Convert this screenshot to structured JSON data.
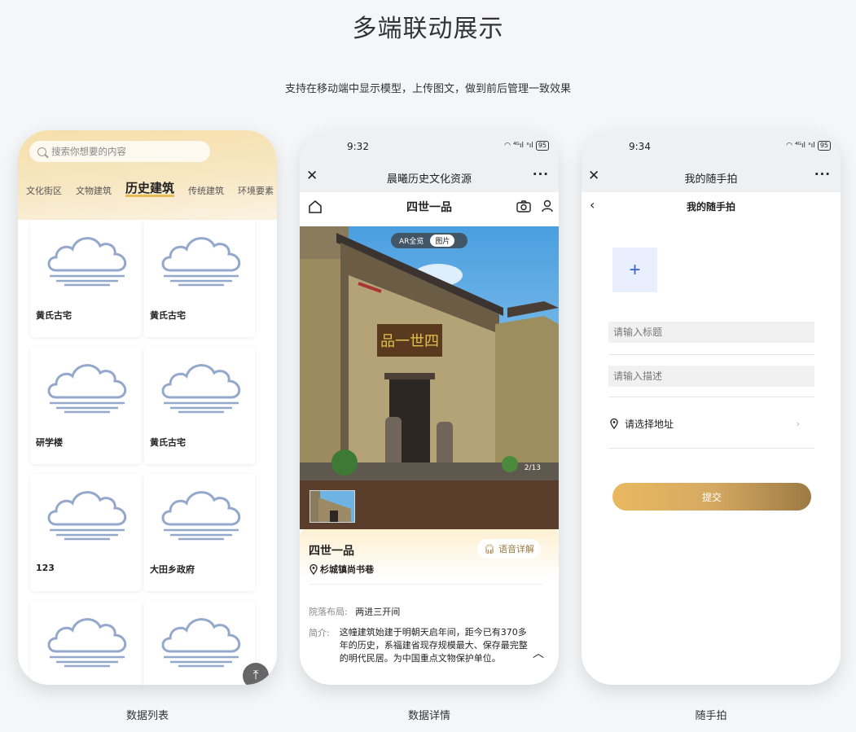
{
  "header": {
    "title": "多端联动展示",
    "subtitle": "支持在移动端中显示模型，上传图文，做到前后管理一致效果"
  },
  "captions": [
    "数据列表",
    "数据详情",
    "随手拍"
  ],
  "phone1": {
    "search_placeholder": "搜索你想要的内容",
    "tabs": [
      "文化街区",
      "文物建筑",
      "历史建筑",
      "传统建筑",
      "环境要素"
    ],
    "active_tab": "历史建筑",
    "cards": [
      "黄氏古宅",
      "黄氏古宅",
      "研学楼",
      "黄氏古宅",
      "123",
      "大田乡政府",
      "",
      ""
    ],
    "back_to_top_icon": "arrow-up-icon"
  },
  "phone2": {
    "time": "9:32",
    "signal": "⁴ᴳıl ˣıl",
    "battery": "95",
    "window_title": "晨曦历史文化资源",
    "nav_title": "四世一品",
    "toggle": {
      "ar": "AR全览",
      "image": "图片"
    },
    "counter": "2/13",
    "name": "四世一品",
    "audio_label": "语音详解",
    "address": "杉城镇尚书巷",
    "layout_label": "院落布局:",
    "layout_value": "两进三开间",
    "intro_label": "简介:",
    "intro_value": "这幢建筑始建于明朝天启年间，距今已有370多年的历史，系福建省现存规模最大、保存最完整的明代民居。为中国重点文物保护单位。"
  },
  "phone3": {
    "time": "9:34",
    "signal": "⁴ᴳıl ˣıl",
    "battery": "95",
    "window_title": "我的随手拍",
    "nav_title": "我的随手拍",
    "upload_symbol": "+",
    "title_placeholder": "请输入标题",
    "desc_placeholder": "请输入描述",
    "address_label": "请选择地址",
    "submit_label": "提交"
  },
  "colors": {
    "accent_gold": "#e9b85f",
    "upload_blue": "#3a63d0",
    "background": "#f5f6f8"
  }
}
